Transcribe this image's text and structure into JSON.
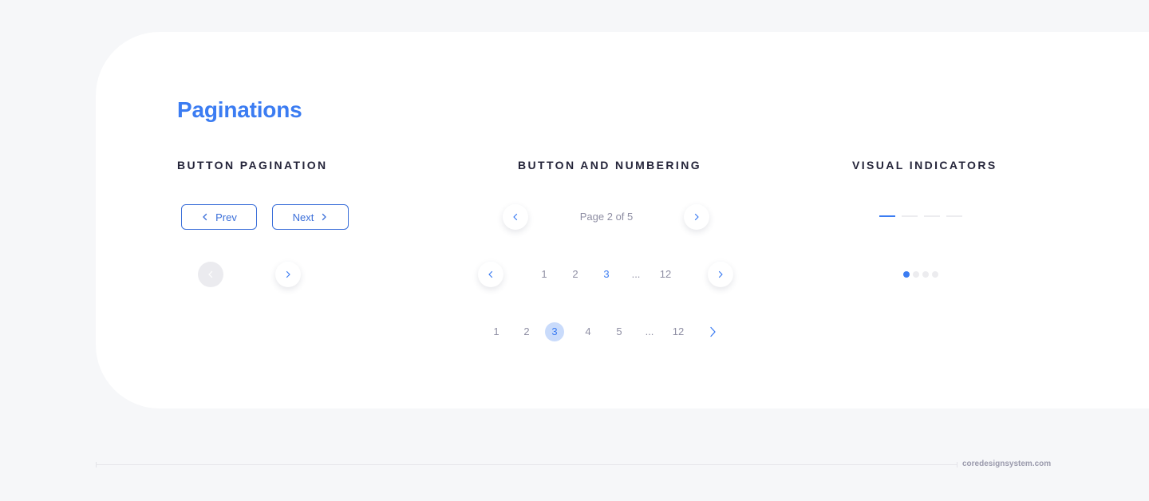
{
  "header": {
    "title": "Paginations"
  },
  "colors": {
    "accent": "#3b7cf2",
    "heading": "#25253a",
    "muted": "#8e8ea3",
    "active_bubble": "#c9dbfb",
    "inactive_indicator": "#ececef",
    "background": "#f6f7f9"
  },
  "sections": {
    "button_pagination": {
      "title": "BUTTON PAGINATION",
      "prev_label": "Prev",
      "next_label": "Next",
      "prev_icon": "chevron-left-icon",
      "next_icon": "chevron-right-icon",
      "circle_prev_disabled": true,
      "circle_next_disabled": false
    },
    "button_and_numbering": {
      "title": "BUTTON AND NUMBERING",
      "page_label": "Page 2 of 5",
      "row2_pages": [
        "1",
        "2",
        "3",
        "...",
        "12"
      ],
      "row2_active": "3",
      "row3_pages": [
        "1",
        "2",
        "3",
        "4",
        "5",
        "...",
        "12"
      ],
      "row3_active": "3"
    },
    "visual_indicators": {
      "title": "VISUAL INDICATORS",
      "bar_count": 4,
      "bar_active_index": 0,
      "dot_count": 4,
      "dot_active_index": 0
    }
  },
  "footer": {
    "site": "coredesignsystem.com"
  }
}
